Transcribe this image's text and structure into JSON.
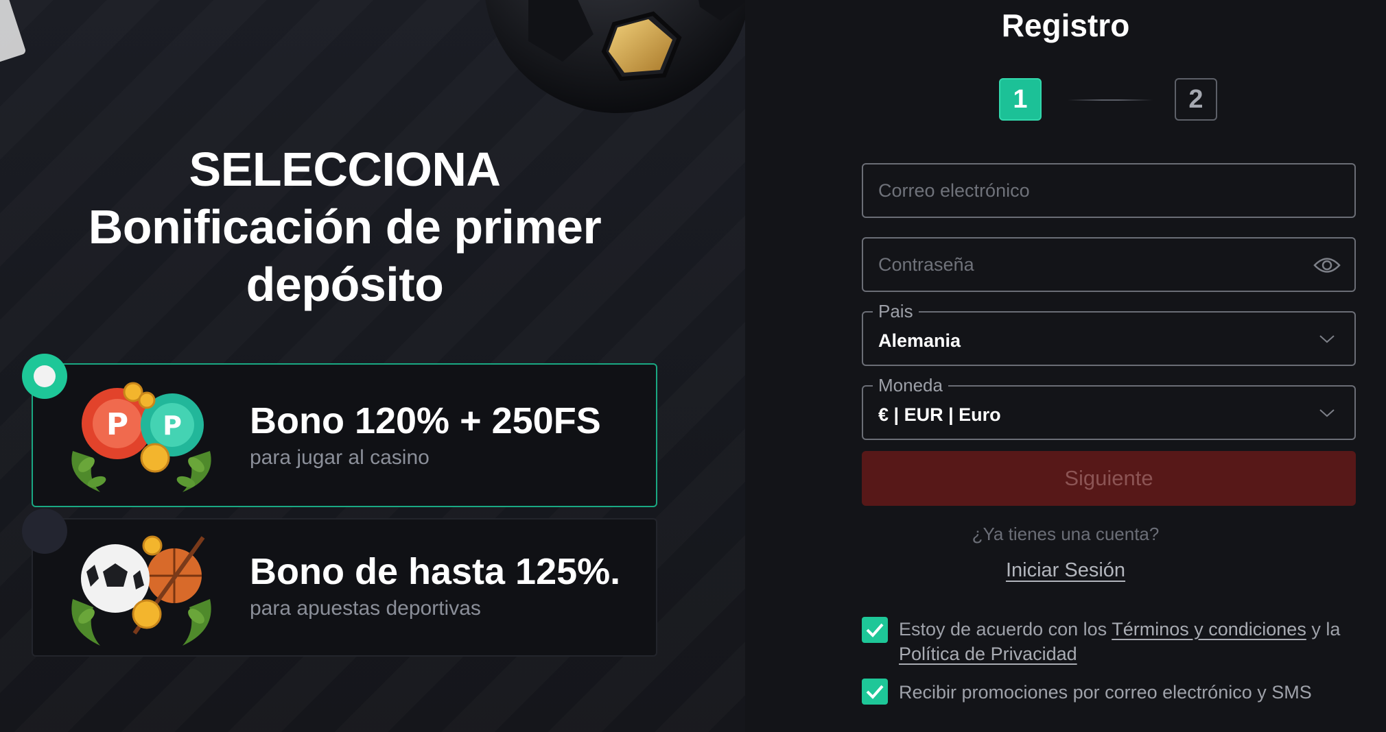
{
  "promo": {
    "title_line1": "SELECCIONA",
    "title_line2": "Bonificación de primer",
    "title_line3": "depósito",
    "bonuses": [
      {
        "title": "Bono 120% + 250FS",
        "subtitle": "para jugar al casino",
        "selected": true,
        "art": "casino-chips-icon"
      },
      {
        "title": "Bono de hasta 125%.",
        "subtitle": "para apuestas deportivas",
        "selected": false,
        "art": "sports-balls-icon"
      }
    ]
  },
  "form": {
    "title": "Registro",
    "steps": [
      "1",
      "2"
    ],
    "active_step": 1,
    "email_placeholder": "Correo electrónico",
    "password_placeholder": "Contraseña",
    "country_label": "Pais",
    "country_value": "Alemania",
    "currency_label": "Moneda",
    "currency_value": "€ | EUR | Euro",
    "next_button": "Siguiente",
    "have_account": "¿Ya tienes una cuenta?",
    "login_link": "Iniciar Sesión",
    "terms_prefix": "Estoy de acuerdo con los ",
    "terms_link": "Términos y condiciones",
    "terms_middle": " y la ",
    "privacy_link": "Política de Privacidad",
    "promo_consent": "Recibir promociones por correo electrónico y SMS",
    "terms_checked": true,
    "promo_checked": true
  },
  "colors": {
    "accent_green": "#1ec798",
    "button_disabled_red": "#571818",
    "panel_bg": "#131418"
  }
}
